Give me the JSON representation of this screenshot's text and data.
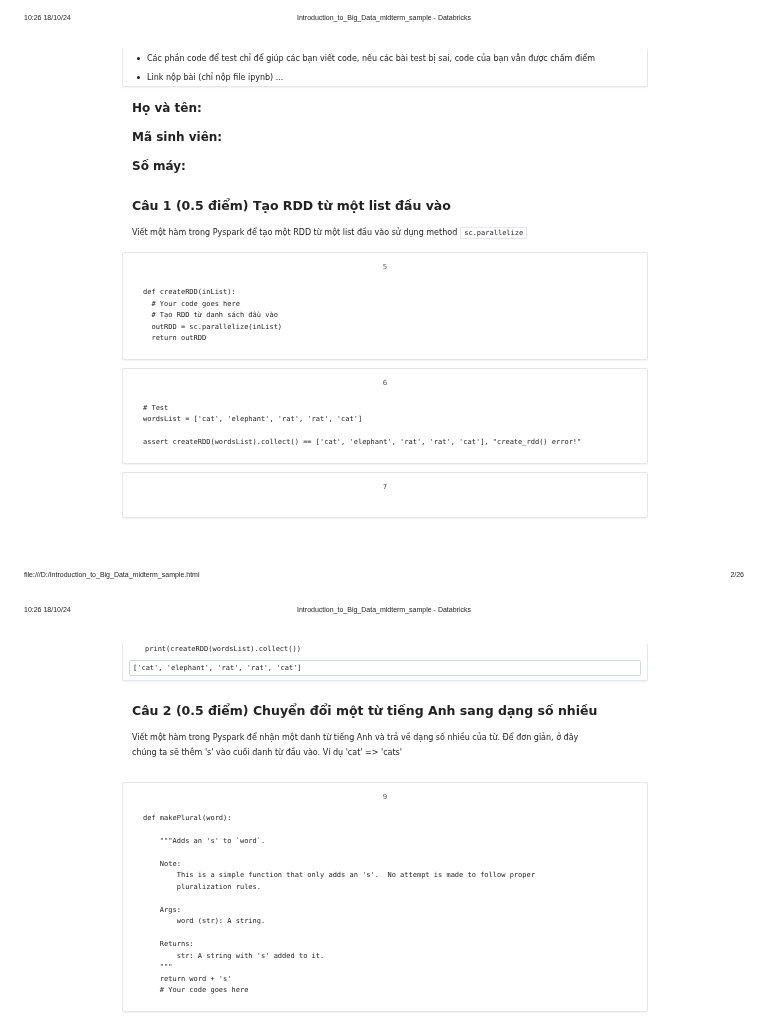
{
  "pages": [
    {
      "header": {
        "time": "10:26 18/10/24",
        "title": "Introduction_to_Big_Data_midterm_sample - Databricks"
      },
      "blocks": [
        {
          "kind": "bullets",
          "items": [
            "Các phần code để test chỉ để giúp các bạn viết code, nếu các bài test bị sai, code của bạn vẫn được chấm điểm",
            "Link nộp bài (chỉ nộp file ipynb) ..."
          ]
        },
        {
          "kind": "field",
          "text": "Họ và tên:"
        },
        {
          "kind": "field",
          "text": "Mã sinh viên:"
        },
        {
          "kind": "field",
          "text": "Số máy:"
        },
        {
          "kind": "heading",
          "text": "Câu 1 (0.5 điểm) Tạo RDD từ một list đầu vào"
        },
        {
          "kind": "paragraph",
          "text": "Viết một hàm trong Pyspark để tạo một RDD từ một list đầu vào sử dụng method",
          "inline_code": "sc.parallelize"
        },
        {
          "kind": "code",
          "number": "5",
          "code": "def createRDD(inList):\n  # Your code goes here\n  # Tạo RDD từ danh sách đầu vào\n  outRDD = sc.parallelize(inList)\n  return outRDD"
        },
        {
          "kind": "code",
          "number": "6",
          "code": "# Test\nwordsList = ['cat', 'elephant', 'rat', 'rat', 'cat']\n\nassert createRDD(wordsList).collect() == ['cat', 'elephant', 'rat', 'rat', 'cat'], \"create_rdd() error!\""
        },
        {
          "kind": "code",
          "number": "7"
        }
      ],
      "footer": {
        "url": "file:///D:/Introduction_to_Big_Data_midterm_sample.html",
        "page": "2/26"
      }
    },
    {
      "header": {
        "time": "10:26 18/10/24",
        "title": "Introduction_to_Big_Data_midterm_sample - Databricks"
      },
      "blocks": [
        {
          "kind": "code_tail",
          "code": "print(createRDD(wordsList).collect())",
          "output": "['cat', 'elephant', 'rat', 'rat', 'cat']"
        },
        {
          "kind": "heading",
          "text": "Câu 2 (0.5 điểm) Chuyển đổi một từ tiếng Anh sang dạng số nhiều"
        },
        {
          "kind": "paragraph",
          "text": "Viết một hàm trong Pyspark để nhận một danh từ tiếng Anh và trả về dạng số nhiều của từ. Để đơn giản, ở đây chúng ta sẽ thêm 's' vào cuối danh từ đầu vào. Ví dụ 'cat' => 'cats'"
        },
        {
          "kind": "code",
          "number": "9",
          "code": "def makePlural(word):\n\n    \"\"\"Adds an 's' to `word`.\n\n    Note:\n        This is a simple function that only adds an 's'.  No attempt is made to follow proper\n        pluralization rules.\n\n    Args:\n        word (str): A string.\n\n    Returns:\n        str: A string with 's' added to it.\n    \"\"\"\n    return word + 's'\n    # Your code goes here"
        }
      ]
    }
  ]
}
